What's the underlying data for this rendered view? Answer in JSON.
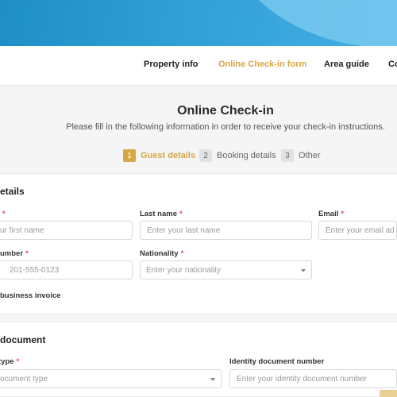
{
  "nav": {
    "items": [
      {
        "label": "Property info"
      },
      {
        "label": "Online Check-in form"
      },
      {
        "label": "Area guide"
      },
      {
        "label": "Co"
      }
    ]
  },
  "hero": {
    "title": "Online Check-in",
    "subtitle": "Please fill in the following information in order to receive your check-in instructions."
  },
  "steps": [
    {
      "number": "1",
      "label": "Guest details"
    },
    {
      "number": "2",
      "label": "Booking details"
    },
    {
      "number": "3",
      "label": "Other"
    }
  ],
  "guest_details": {
    "section_title": "etails",
    "required_mark": "*",
    "first_name": {
      "label": "",
      "placeholder": "ur first name"
    },
    "last_name": {
      "label": "Last name",
      "placeholder": "Enter your last name"
    },
    "email": {
      "label": "Email",
      "placeholder": "Enter your email ad"
    },
    "phone": {
      "label": "umber",
      "placeholder": "201-555-0123"
    },
    "nationality": {
      "label": "Nationality",
      "placeholder": "Enter your nationality"
    },
    "invoice_label": "business invoice"
  },
  "identity": {
    "section_title": "document",
    "type": {
      "label": "type",
      "placeholder": "ocument type"
    },
    "number": {
      "label": "Identity document number",
      "placeholder": "Enter your identity document number"
    }
  },
  "colors": {
    "accent": "#d5a745",
    "banner": "#2f9fd6",
    "required": "#e04a4a"
  }
}
